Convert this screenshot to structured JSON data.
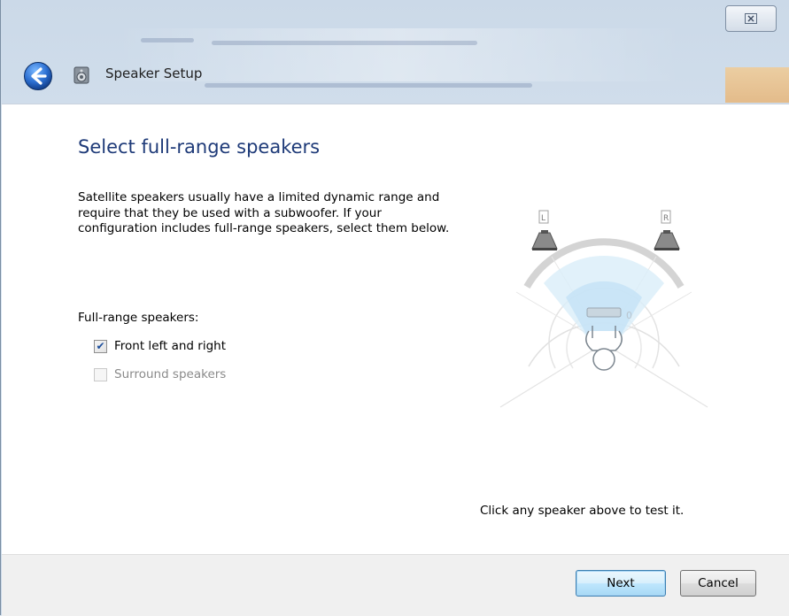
{
  "window": {
    "title": "Speaker Setup",
    "close_glyph": "☒"
  },
  "main": {
    "heading": "Select full-range speakers",
    "description": "Satellite speakers usually have a limited dynamic range and require that they be used with a subwoofer.  If your configuration includes full-range speakers, select them below.",
    "group_label": "Full-range speakers:",
    "options": [
      {
        "label": "Front left and right",
        "checked": true,
        "enabled": true
      },
      {
        "label": "Surround speakers",
        "checked": false,
        "enabled": false
      }
    ],
    "diagram": {
      "left_speaker_label": "L",
      "right_speaker_label": "R"
    },
    "test_hint": "Click any speaker above to test it."
  },
  "footer": {
    "next_label": "Next",
    "cancel_label": "Cancel"
  },
  "colors": {
    "heading": "#1e3a78",
    "accent": "#1c4e9c",
    "disabled_text": "#8a8a8a"
  },
  "icons": [
    "back-arrow-icon",
    "speaker-setup-icon",
    "close-icon",
    "checkbox-check-icon",
    "speaker-icon",
    "listener-icon"
  ]
}
